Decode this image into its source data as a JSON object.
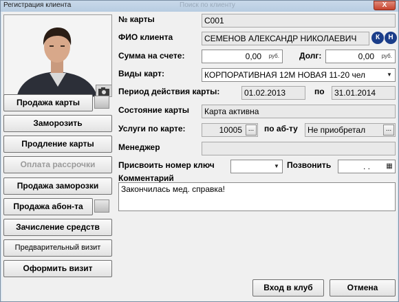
{
  "window": {
    "title": "Регистрация клиента",
    "ghost_title": "Поиск по клиенту",
    "close_label": "X"
  },
  "left_buttons": {
    "sell_card": "Продажа карты",
    "freeze": "Заморозить",
    "extend_card": "Продление карты",
    "installment_payment": "Оплата рассрочки",
    "sell_freeze": "Продажа заморозки",
    "sell_subscription": "Продажа абон-та",
    "credit_funds": "Зачисление средств",
    "preliminary_visit": "Предварительный визит",
    "make_visit": "Оформить визит"
  },
  "form": {
    "card_number_label": "№ карты",
    "card_number_value": "C001",
    "client_name_label": "ФИО клиента",
    "client_name_value": "СЕМЕНОВ АЛЕКСАНДР НИКОЛАЕВИЧ",
    "balance_label": "Сумма на счете:",
    "balance_value": "0,00",
    "balance_unit": "руб.",
    "debt_label": "Долг:",
    "debt_value": "0,00",
    "debt_unit": "руб.",
    "card_types_label": "Виды карт:",
    "card_type_value": "КОРПОРАТИВНАЯ 12М НОВАЯ 11-20 чел",
    "period_label": "Период действия карты:",
    "period_from": "01.02.2013",
    "period_to_label": "по",
    "period_to": "31.01.2014",
    "status_label": "Состояние карты",
    "status_value": "Карта активна",
    "services_label": "Услуги по карте:",
    "services_value": "10005",
    "ellipsis": "...",
    "by_sub_label": "по аб-ту",
    "by_sub_value": "Не приобретал",
    "manager_label": "Менеджер",
    "manager_value": "",
    "key_label": "Присвоить номер ключ",
    "key_value": "",
    "call_label": "Позвонить",
    "call_value": ". .",
    "comment_label": "Комментарий",
    "comment_value": "Закончилась мед. справка!"
  },
  "bottom_buttons": {
    "enter_club": "Вход в клуб",
    "cancel": "Отмена"
  },
  "icons": {
    "k_icon": "К",
    "n_icon": "Н",
    "dropdown": "▼",
    "calendar": "▦"
  },
  "colors": {
    "accent_blue": "#1b3e8a",
    "close_red": "#c6432d"
  }
}
